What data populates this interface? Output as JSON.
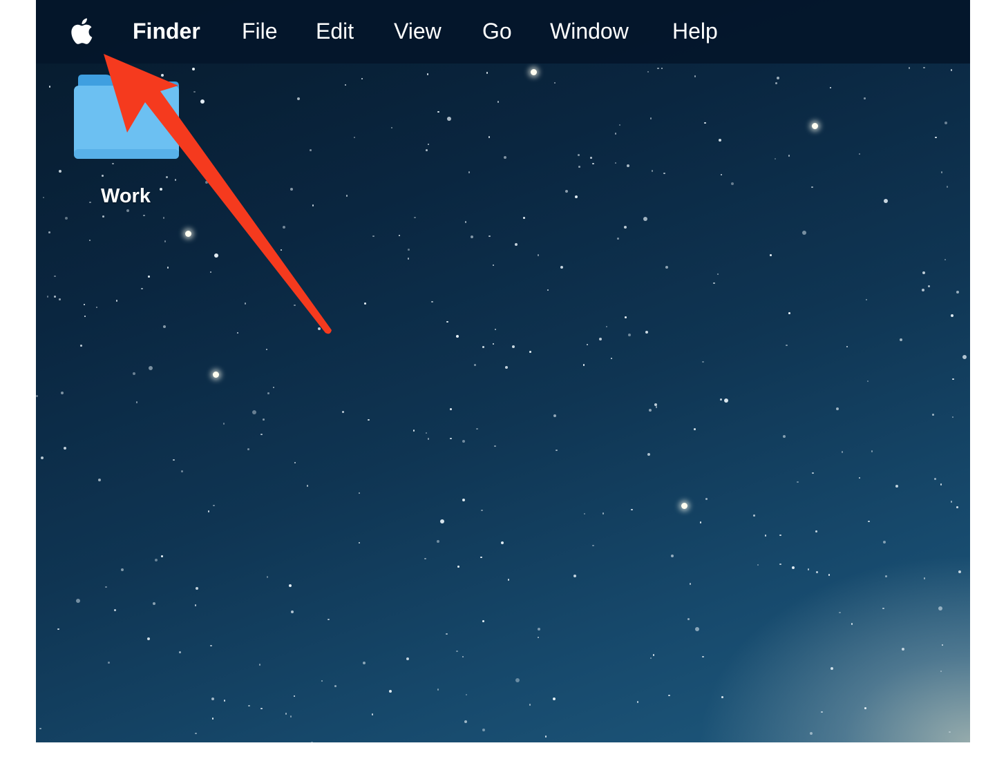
{
  "menubar": {
    "apple_icon": "apple-logo",
    "app_name": "Finder",
    "items": [
      {
        "label": "File"
      },
      {
        "label": "Edit"
      },
      {
        "label": "View"
      },
      {
        "label": "Go"
      },
      {
        "label": "Window"
      },
      {
        "label": "Help"
      }
    ]
  },
  "desktop": {
    "icons": [
      {
        "type": "folder",
        "label": "Work",
        "color": "#6cc0f2"
      }
    ]
  },
  "annotation": {
    "type": "arrow",
    "color": "#f53a1e",
    "points_to": "apple-menu"
  }
}
